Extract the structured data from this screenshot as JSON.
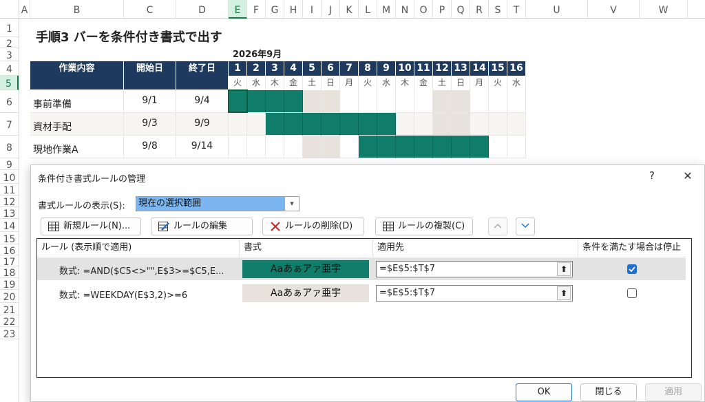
{
  "columns": [
    "A",
    "B",
    "C",
    "D",
    "E",
    "F",
    "G",
    "H",
    "I",
    "J",
    "K",
    "L",
    "M",
    "N",
    "O",
    "P",
    "Q",
    "R",
    "S",
    "T",
    "U",
    "V",
    "W"
  ],
  "rows": [
    "1",
    "2",
    "3",
    "4",
    "5",
    "6",
    "7",
    "8",
    "9",
    "10",
    "11",
    "12",
    "13",
    "14",
    "15",
    "16",
    "17",
    "18",
    "19",
    "20",
    "21",
    "22",
    "23"
  ],
  "sheet": {
    "title": "手順3  バーを条件付き書式で出す",
    "month": "2026年9月",
    "headers": {
      "task": "作業内容",
      "start": "開始日",
      "end": "終了日"
    },
    "days": [
      "1",
      "2",
      "3",
      "4",
      "5",
      "6",
      "7",
      "8",
      "9",
      "10",
      "11",
      "12",
      "13",
      "14",
      "15",
      "16"
    ],
    "weekdays": [
      "火",
      "水",
      "木",
      "金",
      "土",
      "日",
      "月",
      "火",
      "水",
      "木",
      "金",
      "土",
      "日",
      "月",
      "火",
      "水"
    ],
    "tasks": [
      {
        "name": "事前準備",
        "start": "9/1",
        "end": "9/4"
      },
      {
        "name": "資材手配",
        "start": "9/3",
        "end": "9/9"
      },
      {
        "name": "現地作業A",
        "start": "9/8",
        "end": "9/14"
      }
    ]
  },
  "dialog": {
    "title": "条件付き書式ルールの管理",
    "help": "?",
    "close": "✕",
    "show_label": "書式ルールの表示(S):",
    "show_value": "現在の選択範囲",
    "buttons": {
      "new_rule": "新規ルール(N)...",
      "edit_rule": "ルールの編集(E)...",
      "delete_rule": "ルールの削除(D)",
      "duplicate_rule": "ルールの複製(C)"
    },
    "table_headers": {
      "rule": "ルール (表示順で適用)",
      "format": "書式",
      "applies": "適用先",
      "stop": "条件を満たす場合は停止"
    },
    "rules": [
      {
        "rule": "数式: =AND($C5<>\"\",E$3>=$C5,E...",
        "preview": "Aaあぁアァ亜宇",
        "applies": "=$E$5:$T$7",
        "stop": true,
        "preview_color": "#107c6a"
      },
      {
        "rule": "数式: =WEEKDAY(E$3,2)>=6",
        "preview": "Aaあぁアァ亜宇",
        "applies": "=$E$5:$T$7",
        "stop": false,
        "preview_color": "#e7e3dc"
      }
    ],
    "footer": {
      "ok": "OK",
      "close": "閉じる",
      "apply": "適用"
    }
  }
}
